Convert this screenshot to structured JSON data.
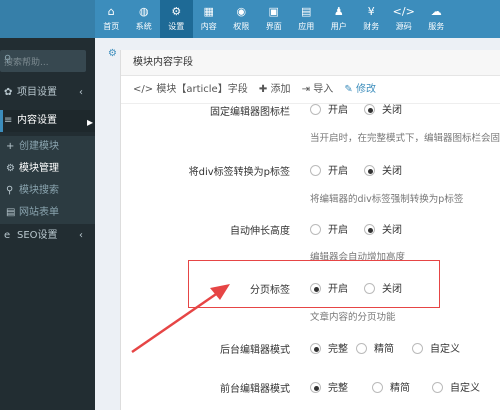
{
  "topnav": [
    {
      "label": "首页",
      "icon": "home-icon",
      "glyph": "⌂"
    },
    {
      "label": "系统",
      "icon": "globe-icon",
      "glyph": "◍"
    },
    {
      "label": "设置",
      "icon": "cogs-icon",
      "glyph": "⚙"
    },
    {
      "label": "内容",
      "icon": "grid-icon",
      "glyph": "▦"
    },
    {
      "label": "权限",
      "icon": "user-circle-icon",
      "glyph": "◉"
    },
    {
      "label": "界面",
      "icon": "html5-icon",
      "glyph": "▣"
    },
    {
      "label": "应用",
      "icon": "apps-icon",
      "glyph": "▤"
    },
    {
      "label": "用户",
      "icon": "user-icon",
      "glyph": "♟"
    },
    {
      "label": "财务",
      "icon": "yen-icon",
      "glyph": "¥"
    },
    {
      "label": "源码",
      "icon": "code-icon",
      "glyph": "</>"
    },
    {
      "label": "服务",
      "icon": "cloud-icon",
      "glyph": "☁"
    }
  ],
  "active_nav_index": 2,
  "sidebar": {
    "search_placeholder": "搜索帮助...",
    "items": [
      {
        "label": "项目设置",
        "icon": "gear-icon",
        "glyph": "✿",
        "arrow": "‹"
      },
      {
        "label": "内容设置",
        "icon": "bars-icon",
        "glyph": "≡",
        "arrow": "∨"
      },
      {
        "label": "创建模块",
        "icon": "plus-icon",
        "glyph": "+"
      },
      {
        "label": "模块管理",
        "icon": "cogs-icon",
        "glyph": "⚙"
      },
      {
        "label": "模块搜索",
        "icon": "search-icon",
        "glyph": "⚲"
      },
      {
        "label": "网站表单",
        "icon": "table-icon",
        "glyph": "▤"
      },
      {
        "label": "SEO设置",
        "icon": "ie-icon",
        "glyph": "e",
        "arrow": "‹"
      }
    ]
  },
  "panel": {
    "title": "模块内容字段",
    "toolbar": {
      "module_label": "模块【article】字段",
      "add_label": "添加",
      "import_label": "导入",
      "edit_label": "修改"
    },
    "rows": [
      {
        "label": "固定编辑器图标栏",
        "on": "开启",
        "off": "关闭",
        "selected": "off",
        "help": "当开启时，在完整模式下，编辑器图标栏会固定"
      },
      {
        "label": "将div标签转换为p标签",
        "on": "开启",
        "off": "关闭",
        "selected": "off",
        "help": "将编辑器的div标签强制转换为p标签"
      },
      {
        "label": "自动伸长高度",
        "on": "开启",
        "off": "关闭",
        "selected": "off",
        "help": "编辑器会自动增加高度"
      },
      {
        "label": "分页标签",
        "on": "开启",
        "off": "关闭",
        "selected": "on",
        "help": "文章内容的分页功能"
      },
      {
        "label": "后台编辑器模式",
        "options": [
          "完整",
          "精简",
          "自定义"
        ],
        "selected": 0
      },
      {
        "label": "前台编辑器模式",
        "options": [
          "完整",
          "精简",
          "自定义"
        ],
        "selected": 0
      }
    ]
  },
  "colors": {
    "topbar": "#3c8dbc",
    "sidebar": "#222d32",
    "highlight": "#e64545"
  }
}
